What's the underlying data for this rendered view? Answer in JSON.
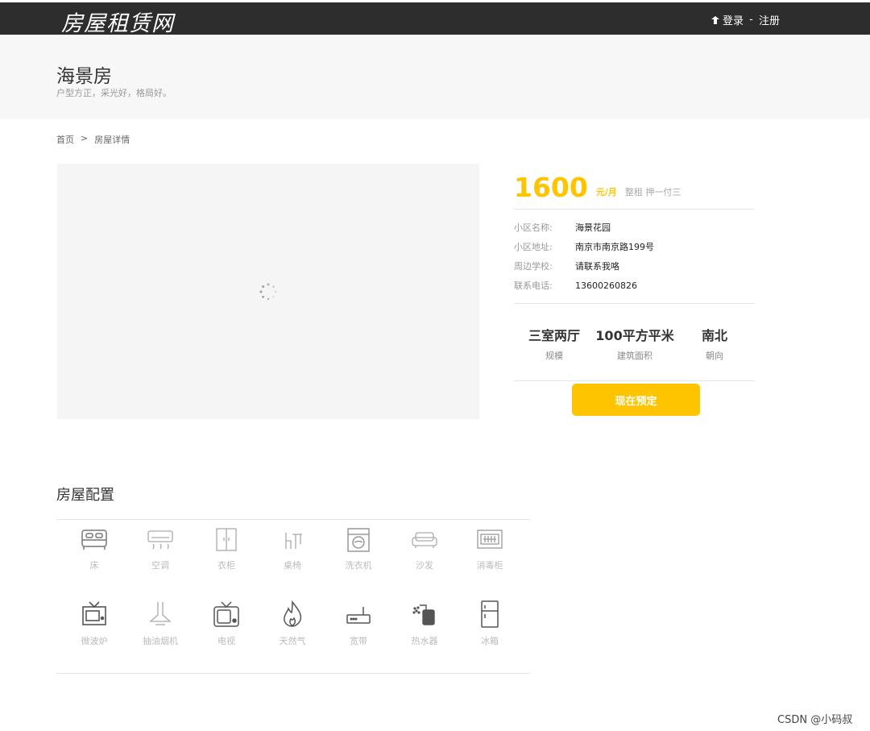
{
  "header": {
    "logo": "房屋租赁网",
    "login": "登录",
    "separator": " - ",
    "register": "注册"
  },
  "hero": {
    "title": "海景房",
    "subtitle": "户型方正，采光好，格局好。"
  },
  "breadcrumb": {
    "home": "首页",
    "sep": ">",
    "current": "房屋详情"
  },
  "pricing": {
    "price": "1600",
    "unit": "元/月",
    "terms": "整租 押一付三"
  },
  "details": [
    {
      "label": "小区名称:",
      "value": "海景花园"
    },
    {
      "label": "小区地址:",
      "value": "南京市南京路199号"
    },
    {
      "label": "周边学校:",
      "value": "请联系我咯"
    },
    {
      "label": "联系电话:",
      "value": "13600260826"
    }
  ],
  "specs": [
    {
      "value": "三室两厅",
      "label": "规模"
    },
    {
      "value": "100平方平米",
      "label": "建筑面积"
    },
    {
      "value": "南北",
      "label": "朝向"
    }
  ],
  "book_button": "现在预定",
  "config": {
    "title": "房屋配置",
    "items": [
      {
        "label": "床",
        "icon": "bed-icon"
      },
      {
        "label": "空调",
        "icon": "air-conditioner-icon"
      },
      {
        "label": "衣柜",
        "icon": "wardrobe-icon"
      },
      {
        "label": "桌椅",
        "icon": "desk-chair-icon"
      },
      {
        "label": "洗衣机",
        "icon": "washing-machine-icon"
      },
      {
        "label": "沙发",
        "icon": "sofa-icon"
      },
      {
        "label": "消毒柜",
        "icon": "sterilizer-icon"
      },
      {
        "label": "微波炉",
        "icon": "microwave-icon"
      },
      {
        "label": "抽油烟机",
        "icon": "range-hood-icon"
      },
      {
        "label": "电视",
        "icon": "tv-icon"
      },
      {
        "label": "天然气",
        "icon": "gas-flame-icon"
      },
      {
        "label": "宽带",
        "icon": "router-icon"
      },
      {
        "label": "热水器",
        "icon": "water-heater-icon"
      },
      {
        "label": "冰箱",
        "icon": "fridge-icon"
      }
    ]
  },
  "watermark": "CSDN @小码叔",
  "colors": {
    "accent": "#ffc400",
    "topbar": "#2d2d2d"
  }
}
